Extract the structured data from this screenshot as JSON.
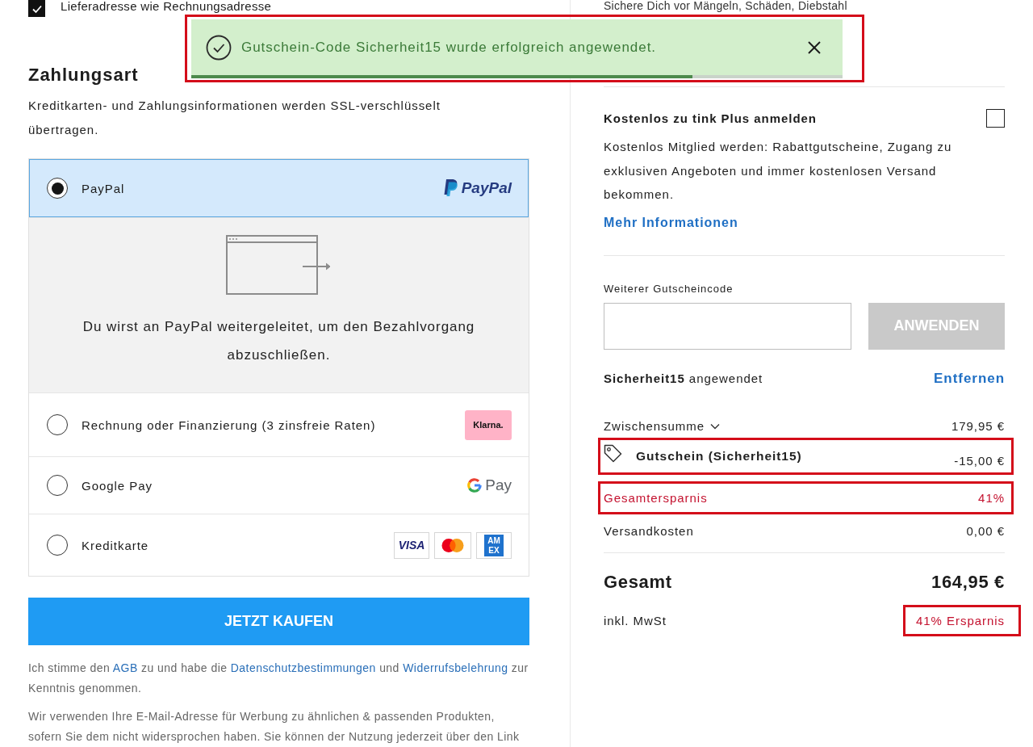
{
  "shipping_same_as_billing": {
    "label": "Lieferadresse wie Rechnungsadresse",
    "checked": true
  },
  "toast": {
    "message": "Gutschein-Code Sicherheit15 wurde erfolgreich angewendet.",
    "level": 0.77,
    "highlighted": true
  },
  "payment": {
    "title": "Zahlungsart",
    "note": "Kreditkarten- und Zahlungsinformationen werden SSL-verschlüsselt übertragen.",
    "methods": [
      {
        "kind": "paypal",
        "label": "PayPal",
        "selected": true,
        "logo_text": "PayPal",
        "redirect_text": "Du wirst an PayPal weitergeleitet, um den Bezahlvorgang abzuschließen."
      },
      {
        "kind": "klarna",
        "label": "Rechnung oder Finanzierung (3 zinsfreie Raten)",
        "selected": false,
        "logo_text": "Klarna."
      },
      {
        "kind": "googlepay",
        "label": "Google Pay",
        "selected": false,
        "logo_text": "Pay"
      },
      {
        "kind": "card",
        "label": "Kreditkarte",
        "selected": false,
        "cards": [
          {
            "kind": "visa",
            "text": "VISA"
          },
          {
            "kind": "mastercard"
          },
          {
            "kind": "amex",
            "text": "AMEX"
          }
        ]
      }
    ],
    "buy_button": "JETZT KAUFEN",
    "legal": [
      [
        {
          "kind": "text",
          "text": "Ich stimme den "
        },
        {
          "kind": "link",
          "text": "AGB"
        },
        {
          "kind": "text",
          "text": " zu und habe die "
        },
        {
          "kind": "link",
          "text": "Datenschutzbestimmungen"
        },
        {
          "kind": "text",
          "text": " und "
        },
        {
          "kind": "link",
          "text": "Widerrufsbelehrung"
        },
        {
          "kind": "text",
          "text": " zur Kenntnis genommen."
        }
      ],
      [
        {
          "kind": "text",
          "text": "Wir verwenden Ihre E-Mail-Adresse für Werbung zu ähnlichen & passenden Produkten, sofern Sie dem nicht widersprochen haben. Sie können der Nutzung jederzeit über den Link"
        }
      ]
    ]
  },
  "protection_note": "Sichere Dich vor Mängeln, Schäden, Diebstahl",
  "plus": {
    "title": "Kostenlos zu tink Plus anmelden",
    "checked": false,
    "text": "Kostenlos Mitglied werden: Rabattgutscheine, Zugang zu exklusiven Angeboten und immer kostenlosen Versand bekommen.",
    "link": "Mehr Informationen"
  },
  "voucher": {
    "label": "Weiterer Gutscheincode",
    "apply_button": {
      "label": "ANWENDEN",
      "disabled": true
    },
    "applied_text": "**Sicherheit15** angewendet",
    "remove_link": "Entfernen"
  },
  "summary": {
    "rows": [
      {
        "kind": "subtotal",
        "label": "Zwischensumme",
        "value": "179,95 €",
        "highlighted": false
      },
      {
        "kind": "voucher",
        "label": "Gutschein (Sicherheit15)",
        "value": "-15,00 €",
        "highlighted": true
      },
      {
        "kind": "savings",
        "label": "Gesamtersparnis",
        "value": "41%",
        "highlighted": true
      },
      {
        "kind": "shipping",
        "label": "Versandkosten",
        "value": "0,00 €",
        "highlighted": false
      }
    ],
    "total": {
      "label": "Gesamt",
      "value": "164,95 €"
    },
    "tax": {
      "label": "inkl. MwSt",
      "savings": "41% Ersparnis",
      "highlighted": true
    }
  }
}
